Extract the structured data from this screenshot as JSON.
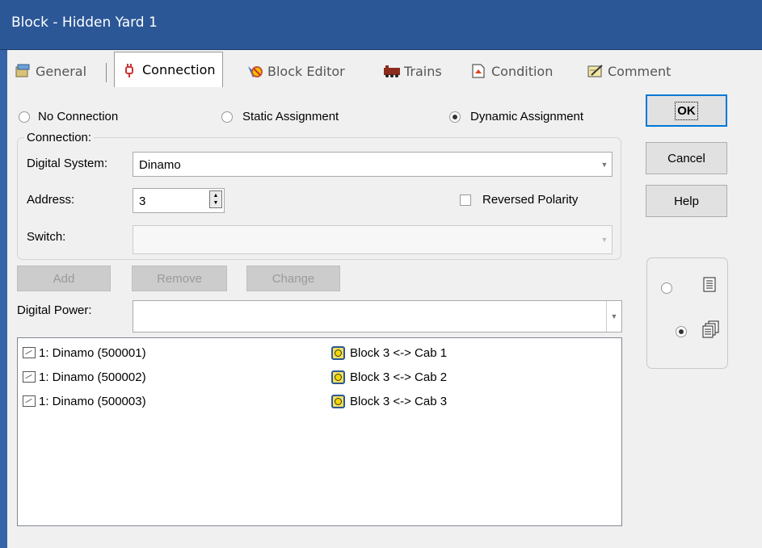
{
  "window": {
    "title": "Block - Hidden Yard 1"
  },
  "tabs": [
    {
      "label": "General",
      "icon": "general-icon"
    },
    {
      "label": "Connection",
      "icon": "plug-icon",
      "active": true
    },
    {
      "label": "Block Editor",
      "icon": "block-editor-icon"
    },
    {
      "label": "Trains",
      "icon": "trains-icon"
    },
    {
      "label": "Condition",
      "icon": "condition-icon"
    },
    {
      "label": "Comment",
      "icon": "comment-icon"
    }
  ],
  "assignment": {
    "no_connection": "No Connection",
    "static": "Static Assignment",
    "dynamic": "Dynamic Assignment",
    "selected": "dynamic"
  },
  "connection": {
    "group_label": "Connection:",
    "digital_system_label": "Digital System:",
    "digital_system_value": "Dinamo",
    "address_label": "Address:",
    "address_value": "3",
    "reversed_polarity_label": "Reversed Polarity",
    "reversed_polarity_checked": false,
    "switch_label": "Switch:",
    "switch_value": ""
  },
  "actions": {
    "add": "Add",
    "remove": "Remove",
    "change": "Change"
  },
  "digital_power": {
    "label": "Digital Power:",
    "value": ""
  },
  "list": {
    "rows": [
      {
        "device": "1: Dinamo (500001)",
        "assignment": "Block 3 <-> Cab 1"
      },
      {
        "device": "1: Dinamo (500002)",
        "assignment": "Block 3 <-> Cab 2"
      },
      {
        "device": "1: Dinamo (500003)",
        "assignment": "Block 3 <-> Cab 3"
      }
    ]
  },
  "buttons": {
    "ok": "OK",
    "cancel": "Cancel",
    "help": "Help"
  },
  "view": {
    "selected": "multi-page",
    "options": [
      "single-page-icon",
      "multi-page-icon"
    ]
  },
  "colors": {
    "titlebar": "#2b5797",
    "accent": "#0078d7",
    "cab_icon": "#f2d800"
  }
}
